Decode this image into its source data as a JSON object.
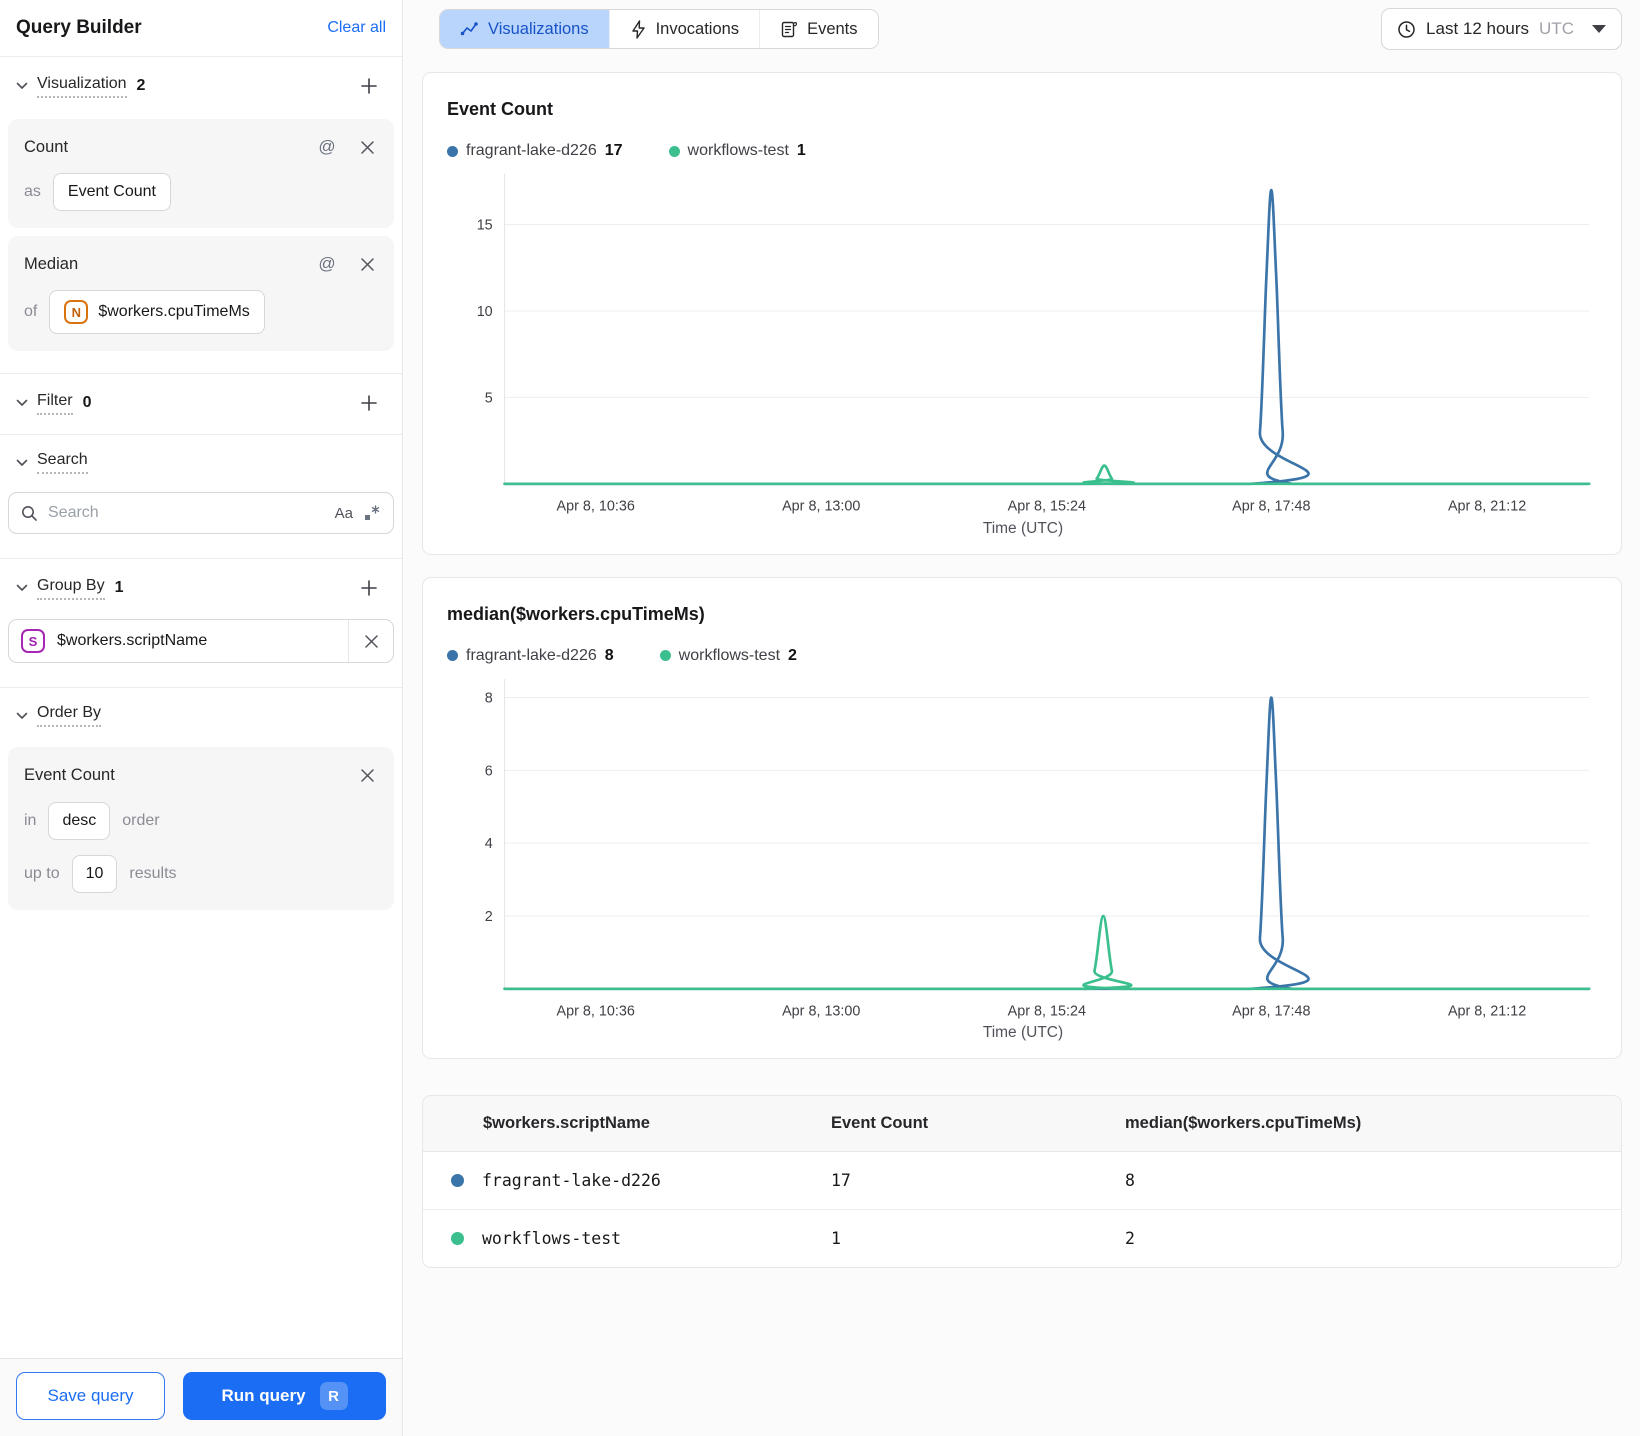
{
  "colors": {
    "accent": "#1b6ef3",
    "series_blue": "#3b74a8",
    "series_green": "#3cbf8e"
  },
  "sidebar": {
    "title": "Query Builder",
    "clear_all": "Clear all",
    "visualization": {
      "label": "Visualization",
      "count": "2",
      "count_card": {
        "title": "Count",
        "at_icon": "@",
        "prefix": "as",
        "value": "Event Count"
      },
      "median_card": {
        "title": "Median",
        "at_icon": "@",
        "prefix": "of",
        "badge": "N",
        "value": "$workers.cpuTimeMs"
      }
    },
    "filter": {
      "label": "Filter",
      "count": "0"
    },
    "search": {
      "label": "Search",
      "placeholder": "Search",
      "case_toggle": "Aa"
    },
    "group_by": {
      "label": "Group By",
      "count": "1",
      "badge": "S",
      "value": "$workers.scriptName"
    },
    "order_by": {
      "label": "Order By",
      "card": {
        "title": "Event Count",
        "in_label": "in",
        "direction": "desc",
        "order_label": "order",
        "up_to_label": "up to",
        "limit": "10",
        "results_label": "results"
      }
    },
    "footer": {
      "save": "Save query",
      "run": "Run query",
      "shortcut": "R"
    }
  },
  "topbar": {
    "tabs": [
      {
        "label": "Visualizations",
        "active": true
      },
      {
        "label": "Invocations",
        "active": false
      },
      {
        "label": "Events",
        "active": false
      }
    ],
    "time_range": {
      "label": "Last 12 hours",
      "timezone": "UTC"
    }
  },
  "chart_data": [
    {
      "type": "line",
      "title": "Event Count",
      "xlabel": "Time (UTC)",
      "x_tick_labels": [
        "Apr 8, 10:36",
        "Apr 8, 13:00",
        "Apr 8, 15:24",
        "Apr 8, 17:48",
        "Apr 8, 21:12"
      ],
      "x_tick_pos": [
        0.084,
        0.292,
        0.5,
        0.707,
        0.906
      ],
      "y_ticks": [
        5,
        10,
        15
      ],
      "y_max": 17.7,
      "grid": true,
      "legend_position": "top",
      "legend": [
        {
          "name": "fragrant-lake-d226",
          "value": "17",
          "color": "#3b74a8"
        },
        {
          "name": "workflows-test",
          "value": "1",
          "color": "#3cbf8e"
        }
      ],
      "series": [
        {
          "name": "fragrant-lake-d226",
          "color": "#3b74a8",
          "points": [
            [
              0,
              0
            ],
            [
              0.688,
              0
            ],
            [
              0.6965,
              3
            ],
            [
              0.7025,
              12
            ],
            [
              0.707,
              17
            ],
            [
              0.7115,
              12
            ],
            [
              0.7175,
              3
            ],
            [
              0.726,
              0
            ],
            [
              1,
              0
            ]
          ]
        },
        {
          "name": "workflows-test",
          "color": "#3cbf8e",
          "points": [
            [
              0,
              0
            ],
            [
              0.538,
              0
            ],
            [
              0.546,
              0.3
            ],
            [
              0.553,
              1.05
            ],
            [
              0.56,
              0.3
            ],
            [
              0.568,
              0
            ],
            [
              1,
              0
            ]
          ]
        }
      ]
    },
    {
      "type": "line",
      "title": "median($workers.cpuTimeMs)",
      "xlabel": "Time (UTC)",
      "x_tick_labels": [
        "Apr 8, 10:36",
        "Apr 8, 13:00",
        "Apr 8, 15:24",
        "Apr 8, 17:48",
        "Apr 8, 21:12"
      ],
      "x_tick_pos": [
        0.084,
        0.292,
        0.5,
        0.707,
        0.906
      ],
      "y_ticks": [
        2,
        4,
        6,
        8
      ],
      "y_max": 8.4,
      "grid": true,
      "legend_position": "top",
      "legend": [
        {
          "name": "fragrant-lake-d226",
          "value": "8",
          "color": "#3b74a8"
        },
        {
          "name": "workflows-test",
          "value": "2",
          "color": "#3cbf8e"
        }
      ],
      "series": [
        {
          "name": "fragrant-lake-d226",
          "color": "#3b74a8",
          "points": [
            [
              0,
              0
            ],
            [
              0.688,
              0
            ],
            [
              0.6965,
              1.4
            ],
            [
              0.7025,
              5.6
            ],
            [
              0.707,
              8
            ],
            [
              0.7115,
              5.6
            ],
            [
              0.7175,
              1.4
            ],
            [
              0.726,
              0
            ],
            [
              1,
              0
            ]
          ]
        },
        {
          "name": "workflows-test",
          "color": "#3cbf8e",
          "points": [
            [
              0,
              0
            ],
            [
              0.536,
              0
            ],
            [
              0.544,
              0.5
            ],
            [
              0.552,
              2
            ],
            [
              0.56,
              0.5
            ],
            [
              0.568,
              0
            ],
            [
              1,
              0
            ]
          ]
        }
      ]
    }
  ],
  "table": {
    "headers": [
      "$workers.scriptName",
      "Event Count",
      "median($workers.cpuTimeMs)"
    ],
    "rows": [
      {
        "color": "#3b74a8",
        "name": "fragrant-lake-d226",
        "event_count": "17",
        "median": "8"
      },
      {
        "color": "#3cbf8e",
        "name": "workflows-test",
        "event_count": "1",
        "median": "2"
      }
    ]
  }
}
